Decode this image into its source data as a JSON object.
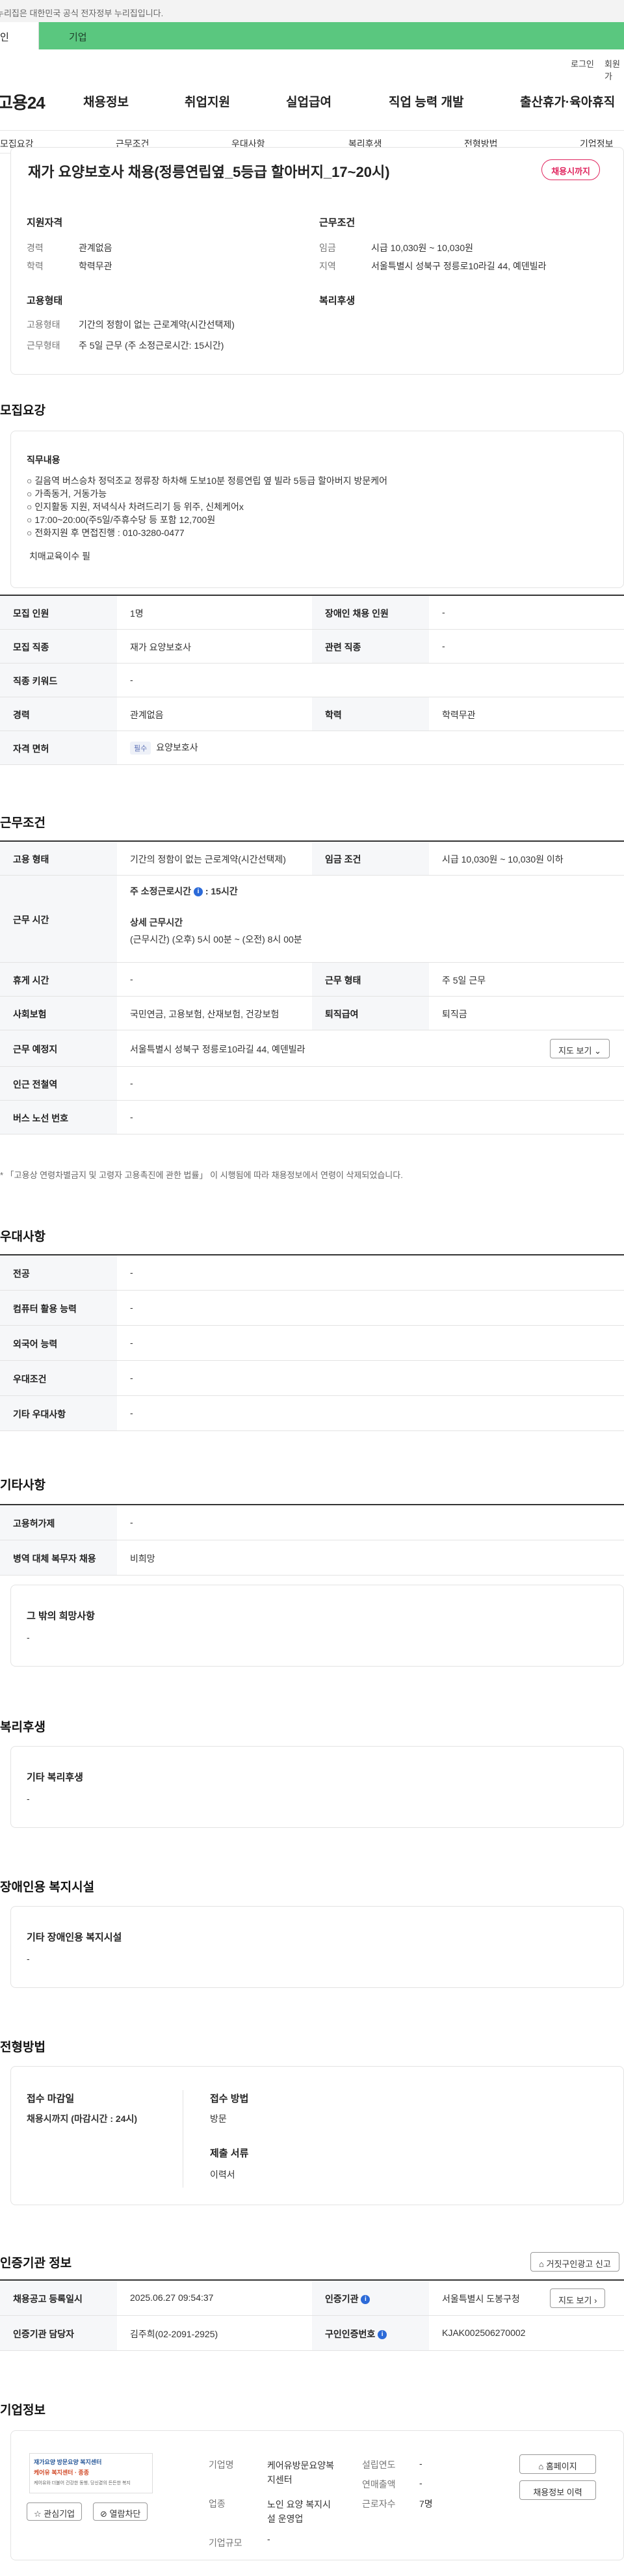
{
  "gov_banner": "누리집은 대한민국 공식 전자정부 누리집입니다.",
  "usertype": {
    "personal": "인",
    "company": "기업"
  },
  "util": {
    "login": "로그인",
    "join": "회원가"
  },
  "gnb": {
    "logo": "고용24",
    "menu": [
      "채용정보",
      "취업지원",
      "실업급여",
      "직업 능력 개발",
      "출산휴가·육아휴직"
    ]
  },
  "anchors": [
    "모집요강",
    "근무조건",
    "우대사항",
    "복리후생",
    "전형방법",
    "기업정보"
  ],
  "summary": {
    "title": "재가 요양보호사 채용(정릉연립옆_5등급 할아버지_17~20시)",
    "badge": "채용시까지",
    "qualification": {
      "heading": "지원자격",
      "career_label": "경력",
      "career_value": "관계없음",
      "edu_label": "학력",
      "edu_value": "학력무관"
    },
    "condition": {
      "heading": "근무조건",
      "wage_label": "임금",
      "wage_value": "시급 10,030원 ~ 10,030원",
      "region_label": "지역",
      "region_value": "서울특별시 성북구 정릉로10라길 44, 예덴빌라"
    },
    "employment": {
      "heading": "고용형태",
      "type_label": "고용형태",
      "type_value": "기간의 정함이 없는 근로계약(시간선택제)",
      "work_label": "근무형태",
      "work_value": "주 5일 근무 (주 소정근로시간: 15시간)"
    },
    "welfare": {
      "heading": "복리후생"
    }
  },
  "recruit": {
    "heading": "모집요강",
    "job_title": "직무내용",
    "job_lines": [
      "○ 길음역 버스승차 정덕조교 정류장 하차해 도보10분 정릉연립 옆 빌라 5등급 할아버지 방문케어",
      "○ 가족동거, 거동가능",
      "○ 인지활동 지원, 저녁식사 차려드리기 등 위주, 신체케어x",
      "○ 17:00~20:00(주5일/주휴수당 등 포함 12,700원",
      "○ 전화지원 후 면접진행 : 010-3280-0477"
    ],
    "job_extra": "치매교육이수 필",
    "rows": [
      {
        "l1": "모집 인원",
        "v1": "1명",
        "l2": "장애인 채용 인원",
        "v2": "-"
      },
      {
        "l1": "모집 직종",
        "v1": "재가 요양보호사",
        "l2": "관련 직종",
        "v2": "-"
      },
      {
        "l1": "직종 키워드",
        "v1": "-"
      },
      {
        "l1": "경력",
        "v1": "관계없음",
        "l2": "학력",
        "v2": "학력무관"
      },
      {
        "l1": "자격 면허",
        "tag": "필수",
        "v1": "요양보호사"
      }
    ]
  },
  "work": {
    "heading": "근무조건",
    "employment_label": "고용 형태",
    "employment_value": "기간의 정함이 없는 근로계약(시간선택제)",
    "wage_cond_label": "임금 조건",
    "wage_cond_value": "시급 10,030원 ~ 10,030원 이하",
    "hours_label": "근무 시간",
    "weekly_hours_label": "주 소정근로시간",
    "weekly_hours_value": ": 15시간",
    "detail_hours_label": "상세 근무시간",
    "detail_hours_value": "(근무시간) (오후) 5시 00분 ~ (오전) 8시 00분",
    "rest_label": "휴게 시간",
    "rest_value": "-",
    "work_type_label": "근무 형태",
    "work_type_value": "주 5일 근무",
    "insurance_label": "사회보험",
    "insurance_value": "국민연금, 고용보험, 산재보험, 건강보험",
    "retire_label": "퇴직급여",
    "retire_value": "퇴직금",
    "place_label": "근무 예정지",
    "place_value": "서울특별시 성북구 정릉로10라길 44, 예덴빌라",
    "map_btn": "지도 보기",
    "subway_label": "인근 전철역",
    "subway_value": "-",
    "bus_label": "버스 노선 번호",
    "bus_value": "-",
    "note": "* 「고용상 연령차별금지 및 고령자 고용촉진에 관한 법률」 이 시행됨에 따라 채용정보에서 연령이 삭제되었습니다."
  },
  "preference": {
    "heading": "우대사항",
    "rows": [
      {
        "l": "전공",
        "v": "-"
      },
      {
        "l": "컴퓨터 활용 능력",
        "v": "-"
      },
      {
        "l": "외국어 능력",
        "v": "-"
      },
      {
        "l": "우대조건",
        "v": "-"
      },
      {
        "l": "기타 우대사항",
        "v": "-"
      }
    ]
  },
  "etc": {
    "heading": "기타사항",
    "rows": [
      {
        "l": "고용허가제",
        "v": "-"
      },
      {
        "l": "병역 대체 복무자 채용",
        "v": "비희망"
      }
    ],
    "other_title": "그 밖의 희망사항",
    "other_value": "-"
  },
  "welfare": {
    "heading": "복리후생",
    "title": "기타 복리후생",
    "value": "-"
  },
  "disability": {
    "heading": "장애인용 복지시설",
    "title": "기타 장애인용 복지시설",
    "value": "-"
  },
  "selection": {
    "heading": "전형방법",
    "deadline_title": "접수 마감일",
    "deadline_value": "채용시까지 (마감시간 : 24시)",
    "method_title": "접수 방법",
    "method_value": "방문",
    "docs_title": "제출 서류",
    "docs_value": "이력서"
  },
  "cert": {
    "heading": "인증기관 정보",
    "report_btn": "거짓구인광고 신고",
    "reg_date_label": "채용공고 등록일시",
    "reg_date_value": "2025.06.27 09:54:37",
    "agency_label": "인증기관",
    "agency_value": "서울특별시 도봉구청",
    "map_btn": "지도 보기",
    "manager_label": "인증기관 담당자",
    "manager_value": "김주희(02-2091-2925)",
    "cert_no_label": "구인인증번호",
    "cert_no_value": "KJAK002506270002"
  },
  "company": {
    "heading": "기업정보",
    "logo_line1": "재가요양 방문요양 복지센터",
    "logo_line2": "케어유 복지센터 · 종종",
    "logo_line3": "케어유와 더불어 건강한 동행, 당신곁의 든든한 복지",
    "interest_btn": "관심기업",
    "block_btn": "열람차단",
    "name_label": "기업명",
    "name_value": "케어유방문요양복지센터",
    "industry_label": "업종",
    "industry_value": "노인 요양 복지시설 운영업",
    "size_label": "기업규모",
    "size_value": "-",
    "founded_label": "설립연도",
    "founded_value": "-",
    "sales_label": "연매출액",
    "sales_value": "-",
    "employees_label": "근로자수",
    "employees_value": "7명",
    "homepage_btn": "홈페이지",
    "history_btn": "채용정보 이력"
  }
}
